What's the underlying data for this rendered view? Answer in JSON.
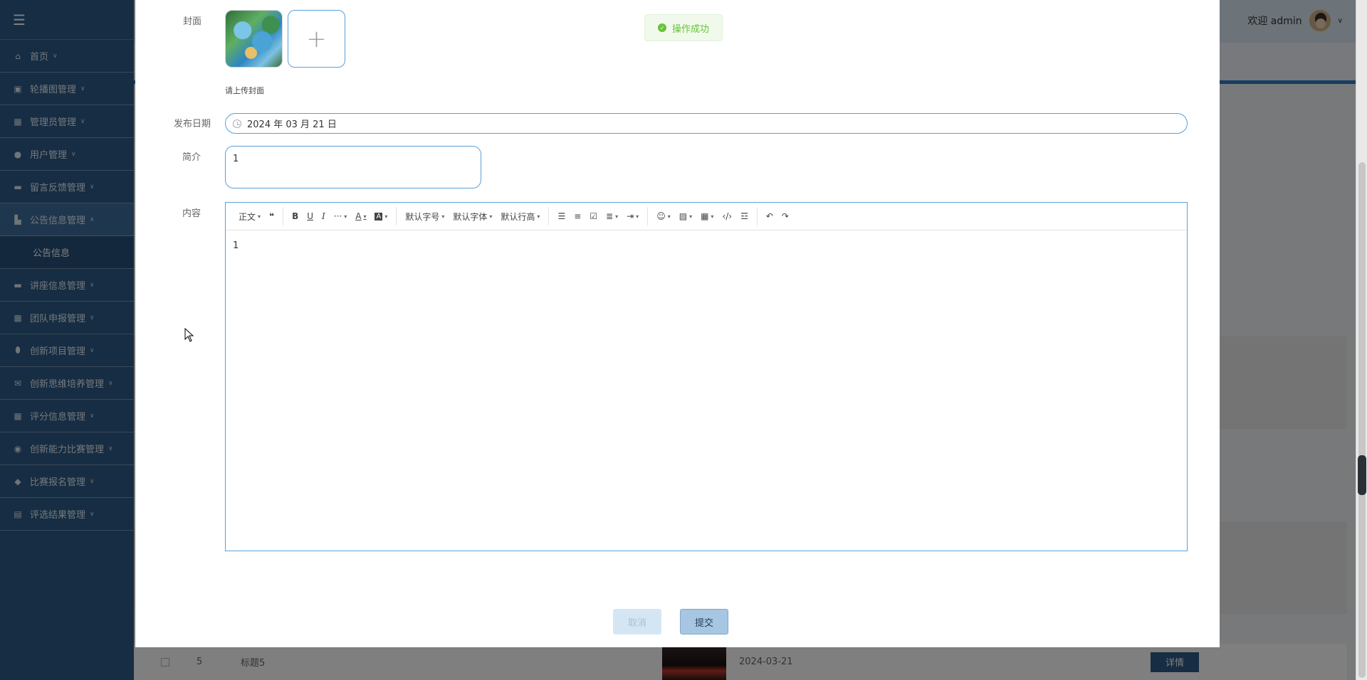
{
  "sidebar": {
    "items": [
      {
        "label": "首页",
        "icon": "home-icon"
      },
      {
        "label": "轮播图管理",
        "icon": "image-icon"
      },
      {
        "label": "管理员管理",
        "icon": "grid-icon"
      },
      {
        "label": "用户管理",
        "icon": "user-icon"
      },
      {
        "label": "留言反馈管理",
        "icon": "monitor-icon"
      },
      {
        "label": "公告信息管理",
        "icon": "truck-icon"
      },
      {
        "label": "讲座信息管理",
        "icon": "monitor-icon"
      },
      {
        "label": "团队申报管理",
        "icon": "grid-icon"
      },
      {
        "label": "创新项目管理",
        "icon": "shield-icon"
      },
      {
        "label": "创新思维培养管理",
        "icon": "mail-icon"
      },
      {
        "label": "评分信息管理",
        "icon": "grid-icon"
      },
      {
        "label": "创新能力比赛管理",
        "icon": "compass-icon"
      },
      {
        "label": "比赛报名管理",
        "icon": "drop-icon"
      },
      {
        "label": "评选结果管理",
        "icon": "table-icon"
      }
    ],
    "sub_item": "公告信息"
  },
  "header": {
    "welcome": "欢迎 admin"
  },
  "background_row": {
    "index": "5",
    "title": "标题5",
    "date": "2024-03-21",
    "detail_label": "详情"
  },
  "dialog": {
    "cover_label": "封面",
    "cover_hint": "请上传封面",
    "date_label": "发布日期",
    "date_value": "2024 年 03 月 21 日",
    "intro_label": "简介",
    "intro_value": "1",
    "content_label": "内容",
    "content_value": "1",
    "toolbar": {
      "heading": "正文",
      "font_size": "默认字号",
      "font_family": "默认字体",
      "line_height": "默认行高"
    },
    "cancel_label": "取消",
    "submit_label": "提交"
  },
  "toast": {
    "message": "操作成功"
  },
  "colors": {
    "sidebar": "#2d5a87",
    "accent": "#5aa0d8",
    "success": "#67c23a"
  }
}
